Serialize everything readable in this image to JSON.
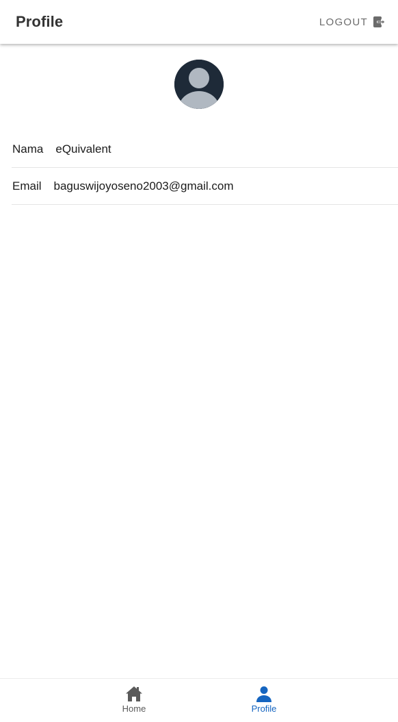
{
  "appbar": {
    "title": "Profile",
    "logout_label": "LOGOUT",
    "logout_icon": "logout-icon"
  },
  "avatar": {
    "icon": "user-avatar-icon",
    "background_color": "#1e2a38",
    "figure_color": "#b0b8c1"
  },
  "profile": {
    "rows": [
      {
        "label": "Nama",
        "value": "eQuivalent"
      },
      {
        "label": "Email",
        "value": "baguswijoyoseno2003@gmail.com"
      }
    ]
  },
  "bottom_nav": {
    "items": [
      {
        "label": "Home",
        "icon": "home-icon",
        "active": false
      },
      {
        "label": "Profile",
        "icon": "person-icon",
        "active": true
      }
    ],
    "active_color": "#1565c0",
    "inactive_color": "#5a5a5a"
  }
}
